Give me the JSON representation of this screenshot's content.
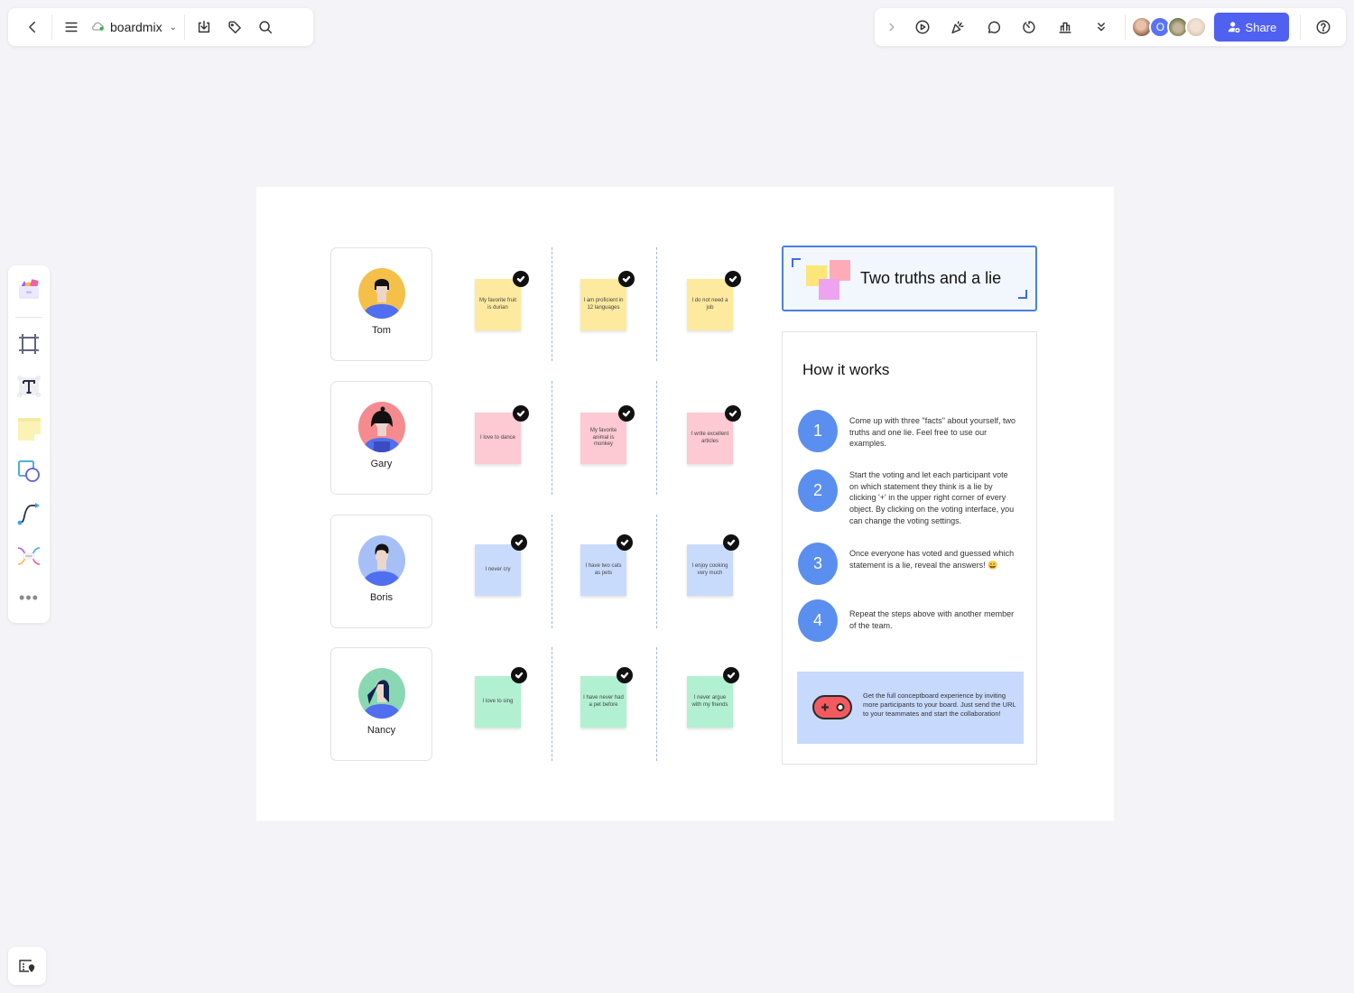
{
  "top_left_toolbar": {
    "back_icon": "chevron-left-icon",
    "menu_icon": "hamburger-menu-icon",
    "cloud_icon": "cloud-synced-icon",
    "board_name": "boardmix",
    "dropdown_icon": "chevron-down-icon",
    "download_icon": "download-icon",
    "tag_icon": "tag-icon",
    "search_icon": "search-icon"
  },
  "top_right_toolbar": {
    "expand_icon": "chevron-right-icon",
    "tools": [
      "present-icon",
      "celebrate-icon",
      "comment-icon",
      "timer-icon",
      "vote-icon",
      "more-chevrons-icon"
    ],
    "avatars": [
      {
        "type": "photo",
        "color": "#c9a48f"
      },
      {
        "type": "initial",
        "initial": "O",
        "color": "#5a73f5"
      },
      {
        "type": "photo",
        "color": "#8d9a70"
      },
      {
        "type": "photo",
        "color": "#e8d4c3"
      }
    ],
    "share_label": "Share",
    "help_icon": "help-icon"
  },
  "left_toolbar": {
    "items": [
      "template-library-icon",
      "frame-tool-icon",
      "text-tool-icon",
      "sticky-note-icon",
      "shape-tool-icon",
      "connector-tool-icon",
      "mindmap-tool-icon",
      "more-tools-icon"
    ]
  },
  "minimap_icon": "minimap-icon",
  "board": {
    "people": [
      {
        "name": "Tom",
        "avatar_bg": "#f5c04a",
        "note_color": "#fdea9e",
        "facts": [
          "My favorite fruit is durian",
          "I am proficient in 12 languages",
          "I do not need a job"
        ]
      },
      {
        "name": "Gary",
        "avatar_bg": "#f58b8f",
        "note_color": "#fdc9d2",
        "facts": [
          "I love to dance",
          "My favorite animal is monkey",
          "I write excellent articles"
        ]
      },
      {
        "name": "Boris",
        "avatar_bg": "#a6c0f7",
        "note_color": "#c9dbfc",
        "facts": [
          "I never cry",
          "I have two cats as pets",
          "I enjoy cooking very much"
        ]
      },
      {
        "name": "Nancy",
        "avatar_bg": "#8ad8b3",
        "note_color": "#b2f0d2",
        "facts": [
          "I love to sing",
          "I have never had a pet before",
          "I never argue with my friends"
        ]
      }
    ],
    "title_card": {
      "title": "Two truths and a lie"
    },
    "how_it_works": {
      "heading": "How it works",
      "steps": [
        {
          "number": "1",
          "text": "Come up with three \"facts\" about yourself, two truths and one lie. Feel free to use our examples."
        },
        {
          "number": "2",
          "text": "Start the voting and let each participant vote on which statement they think is a lie by clicking '+' in the upper right corner of every object. By clicking on the voting interface, you can change the voting settings."
        },
        {
          "number": "3",
          "text": "Once everyone has voted and guessed which statement is a lie, reveal the answers! 😀"
        },
        {
          "number": "4",
          "text": "Repeat the steps above with another member of the team."
        }
      ],
      "promo_text": "Get the full conceptboard experience by inviting more participants to your board. Just send the URL to your teammates and start the collaboration!",
      "promo_icon": "gamepad-icon"
    }
  }
}
